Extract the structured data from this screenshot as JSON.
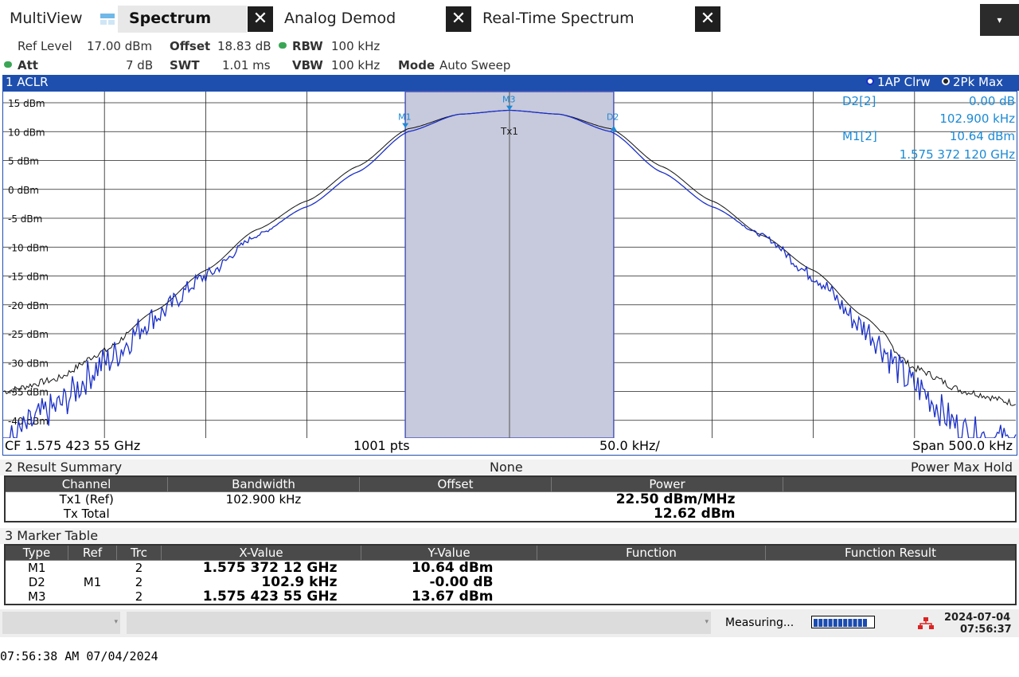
{
  "tabs": [
    {
      "label": "MultiView"
    },
    {
      "label": "Spectrum"
    },
    {
      "label": "Analog Demod"
    },
    {
      "label": "Real-Time Spectrum"
    }
  ],
  "settings": {
    "ref_level_label": "Ref Level",
    "ref_level_value": "17.00 dBm",
    "offset_label": "Offset",
    "offset_value": "18.83 dB",
    "rbw_label": "RBW",
    "rbw_value": "100 kHz",
    "att_label": "Att",
    "att_value": "7 dB",
    "swt_label": "SWT",
    "swt_value": "1.01 ms",
    "vbw_label": "VBW",
    "vbw_value": "100 kHz",
    "mode_label": "Mode",
    "mode_value": "Auto Sweep"
  },
  "window1": {
    "title": "1 ACLR",
    "trace1": "1AP Clrw",
    "trace2": "2Pk Max",
    "markers_info": [
      {
        "label": "D2[2]",
        "value": "0.00 dB"
      },
      {
        "label": "",
        "value": "102.900 kHz"
      },
      {
        "label": "M1[2]",
        "value": "10.64 dBm"
      },
      {
        "label": "",
        "value": "1.575 372 120 GHz"
      }
    ],
    "marker_labels": {
      "m1": "M1",
      "m3": "M3",
      "d2": "D2",
      "tx": "Tx1"
    },
    "cf": "CF 1.575 423 55 GHz",
    "pts": "1001 pts",
    "div": "50.0 kHz/",
    "span": "Span 500.0 kHz"
  },
  "chart_data": {
    "type": "line",
    "ylabel": "dBm",
    "ylim": [
      -43,
      16
    ],
    "y_ticks": [
      "15 dBm",
      "10 dBm",
      "5 dBm",
      "0 dBm",
      "-5 dBm",
      "-10 dBm",
      "-15 dBm",
      "-20 dBm",
      "-25 dBm",
      "-30 dBm",
      "-35 dBm",
      "-40 dBm"
    ],
    "x_unit": "kHz offset from CF",
    "xlim": [
      -250,
      250
    ],
    "series": [
      {
        "name": "1AP Clrw",
        "color": "#1a2fc8",
        "x": [
          -250,
          -225,
          -200,
          -175,
          -150,
          -125,
          -100,
          -75,
          -50,
          -25,
          0,
          25,
          50,
          75,
          100,
          125,
          150,
          175,
          200,
          225,
          250
        ],
        "y": [
          -44,
          -38,
          -30,
          -22,
          -15,
          -8,
          -3,
          3,
          10,
          13,
          13.7,
          13,
          10,
          3,
          -3,
          -8,
          -15,
          -24,
          -34,
          -42,
          -44
        ]
      },
      {
        "name": "2Pk Max",
        "color": "#111111",
        "x": [
          -250,
          -225,
          -200,
          -175,
          -150,
          -125,
          -100,
          -75,
          -50,
          -25,
          0,
          25,
          50,
          75,
          100,
          125,
          150,
          175,
          200,
          225,
          250
        ],
        "y": [
          -35,
          -33,
          -28,
          -21,
          -14,
          -7,
          -2,
          4,
          10.5,
          13,
          13.7,
          13,
          10.5,
          4,
          -2,
          -8,
          -14,
          -22,
          -31,
          -35,
          -37
        ]
      }
    ],
    "channel": {
      "name": "Tx1",
      "bandwidth_khz": 102.9
    },
    "markers": [
      {
        "name": "M1",
        "x_khz": -51.43,
        "y": 10.64
      },
      {
        "name": "M3",
        "x_khz": 0,
        "y": 13.67
      },
      {
        "name": "D2",
        "x_khz": 51.47,
        "y": 10.64
      }
    ]
  },
  "result_summary": {
    "title": "2 Result Summary",
    "mid": "None",
    "right": "Power Max Hold",
    "headers": [
      "Channel",
      "Bandwidth",
      "Offset",
      "Power"
    ],
    "rows": [
      {
        "channel": "Tx1 (Ref)",
        "bandwidth": "102.900 kHz",
        "offset": "",
        "power": "22.50 dBm/MHz"
      },
      {
        "channel": "Tx Total",
        "bandwidth": "",
        "offset": "",
        "power": "12.62 dBm"
      }
    ]
  },
  "marker_table": {
    "title": "3 Marker Table",
    "headers": [
      "Type",
      "Ref",
      "Trc",
      "X-Value",
      "Y-Value",
      "Function",
      "Function Result"
    ],
    "rows": [
      {
        "type": "M1",
        "ref": "",
        "trc": "2",
        "x": "1.575 372 12 GHz",
        "y": "10.64 dBm"
      },
      {
        "type": "D2",
        "ref": "M1",
        "trc": "2",
        "x": "102.9 kHz",
        "y": "-0.00 dB"
      },
      {
        "type": "M3",
        "ref": "",
        "trc": "2",
        "x": "1.575 423 55 GHz",
        "y": "13.67 dBm"
      }
    ]
  },
  "status": {
    "measuring": "Measuring...",
    "date": "2024-07-04",
    "time": "07:56:37"
  },
  "footer": "07:56:38 AM  07/04/2024"
}
